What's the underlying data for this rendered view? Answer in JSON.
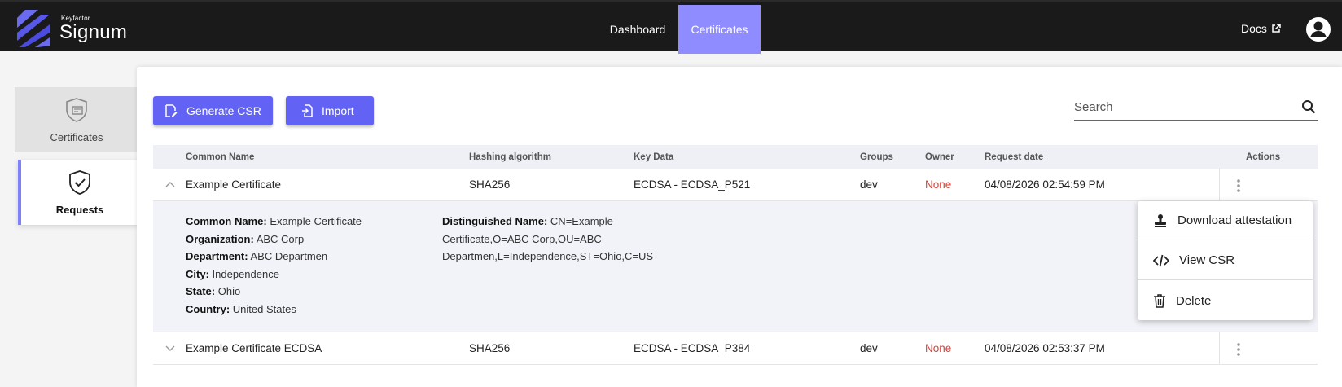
{
  "brand": {
    "small": "Keyfactor",
    "name": "Signum"
  },
  "nav": {
    "dashboard": "Dashboard",
    "certificates": "Certificates",
    "docs": "Docs",
    "active_color": "#8f8cff"
  },
  "sidebar": {
    "items": [
      {
        "label": "Certificates"
      },
      {
        "label": "Requests",
        "active": true
      }
    ]
  },
  "toolbar": {
    "generate_csr": "Generate CSR",
    "import": "Import",
    "button_color": "#6263f5"
  },
  "search": {
    "placeholder": "Search"
  },
  "table": {
    "columns": [
      "Common Name",
      "Hashing algorithm",
      "Key Data",
      "Groups",
      "Owner",
      "Request date",
      "Actions"
    ],
    "rows": [
      {
        "common_name": "Example Certificate",
        "hashing": "SHA256",
        "key_data": "ECDSA - ECDSA_P521",
        "groups": "dev",
        "owner": "None",
        "date": "04/08/2026 02:54:59 PM",
        "expanded": true
      },
      {
        "common_name": "Example Certificate ECDSA",
        "hashing": "SHA256",
        "key_data": "ECDSA - ECDSA_P384",
        "groups": "dev",
        "owner": "None",
        "date": "04/08/2026 02:53:37 PM",
        "expanded": false
      }
    ]
  },
  "details": {
    "common_name_label": "Common Name:",
    "common_name": "Example Certificate",
    "organization_label": "Organization:",
    "organization": "ABC Corp",
    "department_label": "Department:",
    "department": "ABC Departmen",
    "city_label": "City:",
    "city": "Independence",
    "state_label": "State:",
    "state": "Ohio",
    "country_label": "Country:",
    "country": "United States",
    "dn_label": "Distinguished Name:",
    "dn_line1": "CN=Example",
    "dn_line2": "Certificate,O=ABC Corp,OU=ABC",
    "dn_line3": "Departmen,L=Independence,ST=Ohio,C=US"
  },
  "menu": {
    "items": [
      "Download attestation",
      "View CSR",
      "Delete"
    ]
  },
  "colors": {
    "owner_none": "#d9433c"
  }
}
